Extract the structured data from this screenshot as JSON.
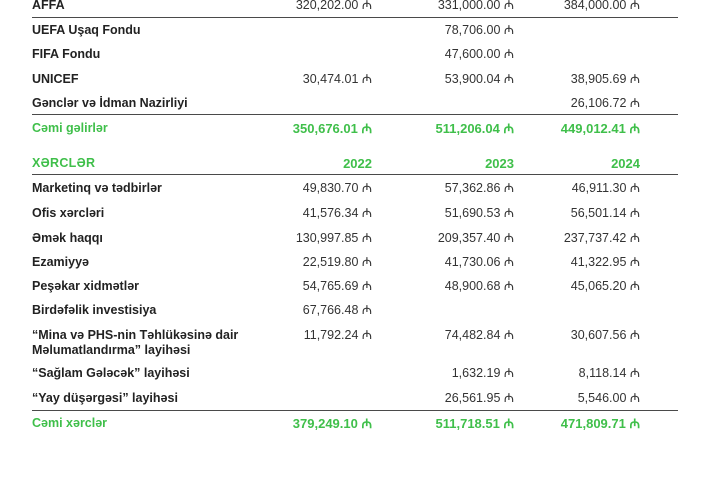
{
  "income_rows": [
    {
      "label": "AFFA",
      "y2022": "320,202.00 ₼",
      "y2023": "331,000.00 ₼",
      "y2024": "384,000.00 ₼"
    },
    {
      "label": "UEFA Uşaq Fondu",
      "y2022": "",
      "y2023": "78,706.00 ₼",
      "y2024": ""
    },
    {
      "label": "FIFA Fondu",
      "y2022": "",
      "y2023": "47,600.00 ₼",
      "y2024": ""
    },
    {
      "label": "UNICEF",
      "y2022": "30,474.01 ₼",
      "y2023": "53,900.04 ₼",
      "y2024": "38,905.69 ₼"
    },
    {
      "label": "Gənclər və İdman Nazirliyi",
      "y2022": "",
      "y2023": "",
      "y2024": "26,106.72 ₼"
    }
  ],
  "income_total": {
    "label": "Cəmi gəlirlər",
    "y2022": "350,676.01 ₼",
    "y2023": "511,206.04 ₼",
    "y2024": "449,012.41 ₼"
  },
  "expenses_header": {
    "label": "XƏRCLƏR",
    "y2022": "2022",
    "y2023": "2023",
    "y2024": "2024"
  },
  "expense_rows": [
    {
      "label": "Marketinq və tədbirlər",
      "y2022": "49,830.70 ₼",
      "y2023": "57,362.86 ₼",
      "y2024": "46,911.30 ₼"
    },
    {
      "label": "Ofis xərcləri",
      "y2022": "41,576.34 ₼",
      "y2023": "51,690.53 ₼",
      "y2024": "56,501.14 ₼"
    },
    {
      "label": "Əmək haqqı",
      "y2022": "130,997.85 ₼",
      "y2023": "209,357.40 ₼",
      "y2024": "237,737.42 ₼"
    },
    {
      "label": "Ezamiyyə",
      "y2022": "22,519.80 ₼",
      "y2023": "41,730.06 ₼",
      "y2024": "41,322.95 ₼"
    },
    {
      "label": "Peşəkar xidmətlər",
      "y2022": "54,765.69 ₼",
      "y2023": "48,900.68 ₼",
      "y2024": "45,065.20 ₼"
    },
    {
      "label": "Birdəfəlik investisiya",
      "y2022": "67,766.48 ₼",
      "y2023": "",
      "y2024": ""
    },
    {
      "label": "“Mina və PHS-nin Təhlükəsinə dair\nMəlumatlandırma” layihəsi",
      "y2022": "11,792.24 ₼",
      "y2023": "74,482.84 ₼",
      "y2024": "30,607.56 ₼"
    },
    {
      "label": "“Sağlam Gələcək” layihəsi",
      "y2022": "",
      "y2023": "1,632.19 ₼",
      "y2024": "8,118.14 ₼"
    },
    {
      "label": "“Yay düşərgəsi” layihəsi",
      "y2022": "",
      "y2023": "26,561.95 ₼",
      "y2024": "5,546.00 ₼"
    }
  ],
  "expense_total": {
    "label": "Cəmi xərclər",
    "y2022": "379,249.10 ₼",
    "y2023": "511,718.51 ₼",
    "y2024": "471,809.71 ₼"
  },
  "colors": {
    "accent_green": "#3fbf4a",
    "text": "#222222",
    "rule": "#4a4a4a"
  }
}
